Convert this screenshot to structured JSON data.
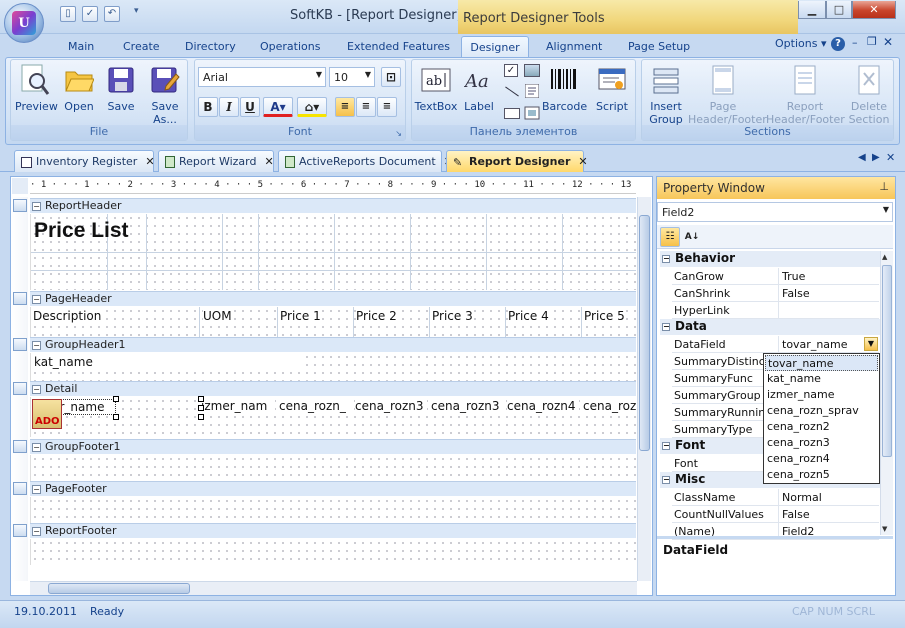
{
  "window": {
    "title": "SoftKB - [Report Designer]",
    "tools_context": "Report Designer Tools"
  },
  "app_logo": "U",
  "ribbon_tabs": [
    "Main",
    "Create",
    "Directory",
    "Operations",
    "Extended Features",
    "Designer",
    "Alignment",
    "Page Setup"
  ],
  "options_label": "Options",
  "groups": {
    "file": {
      "label": "File",
      "buttons": [
        "Preview",
        "Open",
        "Save",
        "Save As..."
      ]
    },
    "font": {
      "label": "Font",
      "font_name": "Arial",
      "font_size": "10"
    },
    "elements": {
      "label": "Панель элементов",
      "buttons": [
        "TextBox",
        "Label",
        "Barcode",
        "Script"
      ]
    },
    "sections": {
      "label": "Sections",
      "buttons": [
        "Insert Group",
        "Page Header/Footer",
        "Report Header/Footer",
        "Delete Section"
      ]
    }
  },
  "doc_tabs": [
    "Inventory Register",
    "Report Wizard",
    "ActiveReports Document",
    "Report Designer"
  ],
  "ruler_text": "· 1 · · · 1 · · · 2 · · · 3 · · · 4 · · · 5 · · · 6 · · · 7 · · · 8 · · · 9 · · · 10 · · · 11 · · · 12 · · · 13 · · · 14 · · · 15 · · · 16 ·",
  "sections": {
    "report_header": "ReportHeader",
    "page_header": "PageHeader",
    "group_header": "GroupHeader1",
    "detail": "Detail",
    "group_footer": "GroupFooter1",
    "page_footer": "PageFooter",
    "report_footer": "ReportFooter"
  },
  "fields": {
    "price_list": "Price List",
    "description": "Description",
    "uom": "UOM",
    "price_headers": [
      "Price 1",
      "Price 2",
      "Price 3",
      "Price 4",
      "Price 5"
    ],
    "kat_name": "kat_name",
    "tovar_name": "tovar_name",
    "izmer_nam": "izmer_nam",
    "detail_cells": [
      "cena_rozn_",
      "cena_rozn3",
      "cena_rozn3",
      "cena_rozn4",
      "cena_roz"
    ],
    "ado": "ADO"
  },
  "property_window": {
    "title": "Property Window",
    "object": "Field2",
    "categories": {
      "behavior": "Behavior",
      "data": "Data",
      "font": "Font",
      "misc": "Misc"
    },
    "behavior_rows": [
      {
        "name": "CanGrow",
        "value": "True"
      },
      {
        "name": "CanShrink",
        "value": "False"
      },
      {
        "name": "HyperLink",
        "value": ""
      }
    ],
    "data_rows": [
      {
        "name": "DataField",
        "value": "tovar_name"
      },
      {
        "name": "SummaryDistinctField",
        "value": ""
      },
      {
        "name": "SummaryFunc",
        "value": ""
      },
      {
        "name": "SummaryGroup",
        "value": ""
      },
      {
        "name": "SummaryRunning",
        "value": ""
      },
      {
        "name": "SummaryType",
        "value": ""
      }
    ],
    "font_rows": [
      {
        "name": "Font",
        "value": ""
      }
    ],
    "misc_rows": [
      {
        "name": "ClassName",
        "value": "Normal"
      },
      {
        "name": "CountNullValues",
        "value": "False"
      },
      {
        "name": "(Name)",
        "value": "Field2"
      }
    ],
    "dropdown_options": [
      "tovar_name",
      "kat_name",
      "izmer_name",
      "cena_rozn_sprav",
      "cena_rozn2",
      "cena_rozn3",
      "cena_rozn4",
      "cena_rozn5"
    ],
    "description_title": "DataField"
  },
  "status": {
    "date": "19.10.2011",
    "state": "Ready",
    "indicators": "CAP  NUM  SCRL"
  }
}
